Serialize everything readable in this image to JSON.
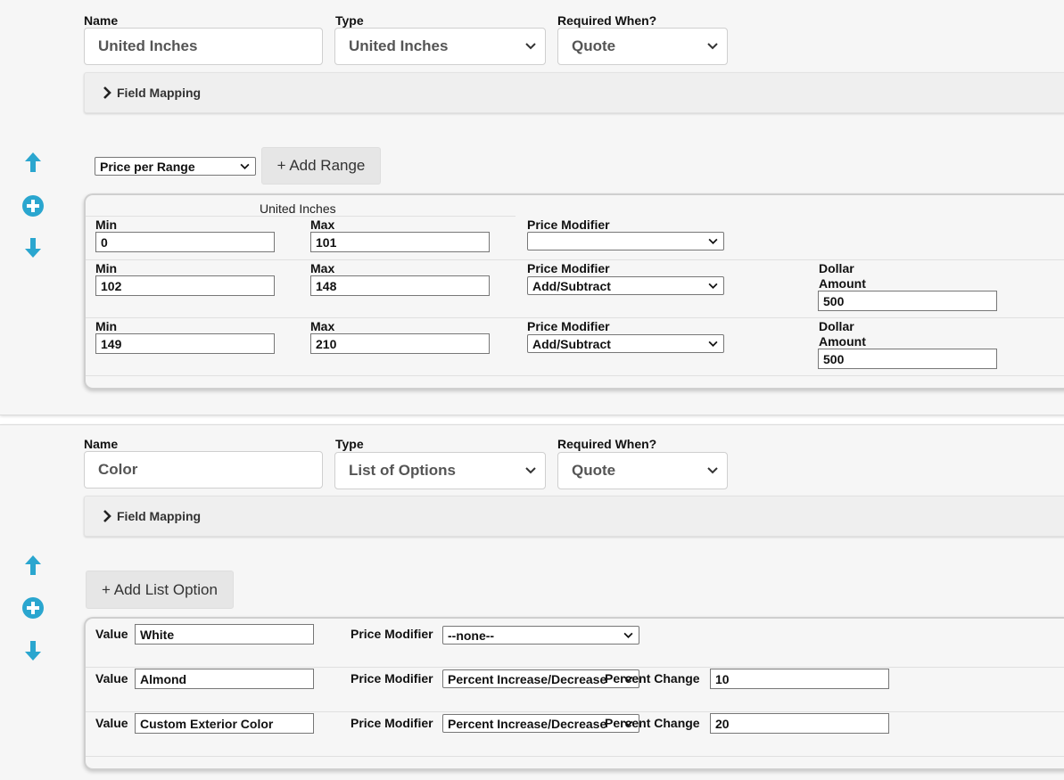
{
  "fields": [
    {
      "labels": {
        "name": "Name",
        "type": "Type",
        "required": "Required When?"
      },
      "name_value": "United Inches",
      "type_value": "United Inches",
      "required_value": "Quote",
      "field_mapping": "Field Mapping",
      "pricing_select": "Price per Range",
      "add_button": "+ Add Range",
      "range_header": "United Inches",
      "rows": [
        {
          "min_label": "Min",
          "min": "0",
          "max_label": "Max",
          "max": "101",
          "modifier_label": "Price Modifier",
          "modifier": "",
          "amount_label": "",
          "amount": ""
        },
        {
          "min_label": "Min",
          "min": "102",
          "max_label": "Max",
          "max": "148",
          "modifier_label": "Price Modifier",
          "modifier": "Add/Subtract",
          "amount_label_1": "Dollar",
          "amount_label_2": "Amount",
          "amount": "500"
        },
        {
          "min_label": "Min",
          "min": "149",
          "max_label": "Max",
          "max": "210",
          "modifier_label": "Price Modifier",
          "modifier": "Add/Subtract",
          "amount_label_1": "Dollar",
          "amount_label_2": "Amount",
          "amount": "500"
        }
      ]
    },
    {
      "labels": {
        "name": "Name",
        "type": "Type",
        "required": "Required When?"
      },
      "name_value": "Color",
      "type_value": "List of Options",
      "required_value": "Quote",
      "field_mapping": "Field Mapping",
      "add_button": "+ Add List Option",
      "rows": [
        {
          "value_label": "Value",
          "value": "White",
          "modifier_label": "Price Modifier",
          "modifier": "--none--",
          "change_label": "",
          "change": ""
        },
        {
          "value_label": "Value",
          "value": "Almond",
          "modifier_label": "Price Modifier",
          "modifier": "Percent Increase/Decrease",
          "change_label": "Percent Change",
          "change": "10"
        },
        {
          "value_label": "Value",
          "value": "Custom Exterior Color",
          "modifier_label": "Price Modifier",
          "modifier": "Percent Increase/Decrease",
          "change_label": "Percent Change",
          "change": "20"
        }
      ]
    }
  ],
  "icons": {
    "up": "arrow-up-icon",
    "add": "plus-circle-icon",
    "down": "arrow-down-icon"
  },
  "colors": {
    "accent": "#2aa6cf"
  }
}
